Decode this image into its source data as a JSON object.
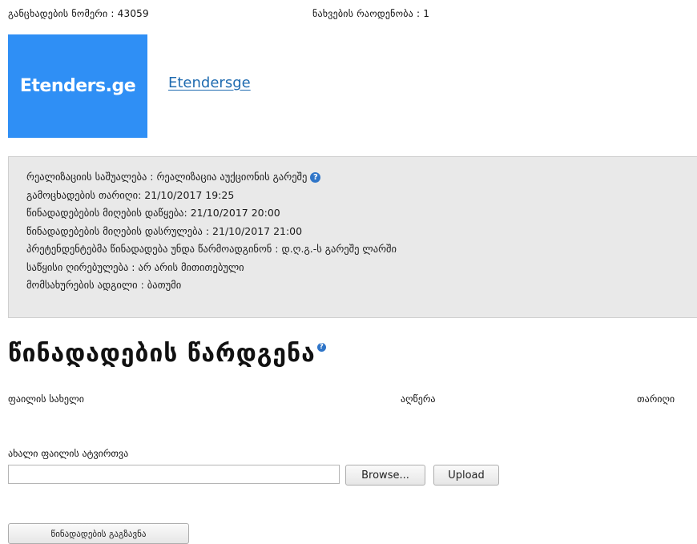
{
  "header": {
    "application_number": "განცხადების ნომერი : 43059",
    "view_count": "ნახვების რაოდენობა : 1"
  },
  "logo": {
    "text": "Etenders.ge"
  },
  "site_link": {
    "label": "Etendersge"
  },
  "info": {
    "lines": [
      "რეალიზაციის საშუალება : რეალიზაცია აუქციონის გარეშე",
      "გამოცხადების თარიღი: 21/10/2017 19:25",
      "წინადადებების მიღების დაწყება: 21/10/2017 20:00",
      "წინადადებების მიღების დასრულება : 21/10/2017 21:00",
      "პრეტენდენტებმა წინადადება უნდა წარმოადგინონ : დ.ღ.გ.-ს გარეშე ლარში",
      "საწყისი ღირებულება : არ არის მითითებული",
      "მომსახურების ადგილი : ბათუმი"
    ],
    "help_symbol": "?"
  },
  "proposal_section": {
    "heading": "წინადადების წარდგენა",
    "help_symbol": "?"
  },
  "files_table": {
    "columns": [
      "ფაილის სახელი",
      "აღწერა",
      "თარიღი"
    ]
  },
  "upload": {
    "label": "ახალი ფაილის ატვირთვა",
    "browse_label": "Browse...",
    "upload_label": "Upload"
  },
  "submit": {
    "label": "წინადადების გაგზავნა"
  },
  "colors": {
    "logo_background": "#2f8ff5",
    "link": "#1f6bb0",
    "info_background": "#e9e9e9",
    "help_icon": "#2f75c8"
  }
}
